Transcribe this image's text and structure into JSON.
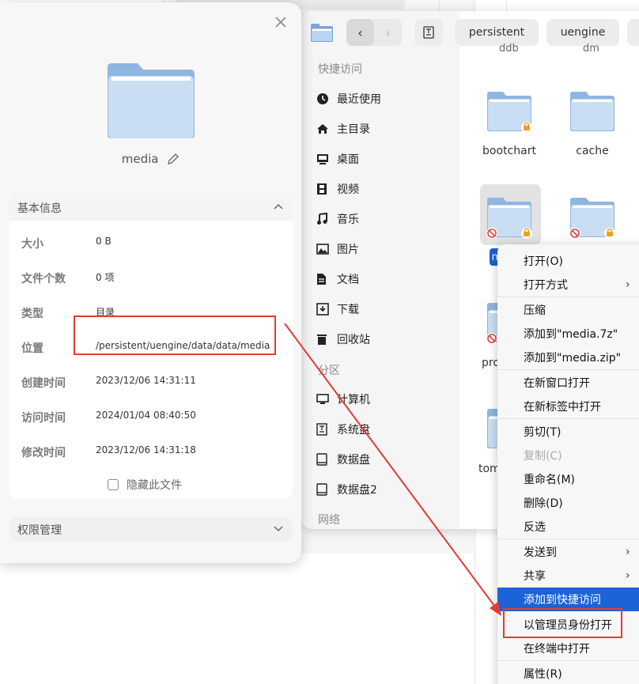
{
  "file_manager": {
    "nav": {
      "back": "‹",
      "forward": "›"
    },
    "breadcrumbs": [
      "persistent",
      "uengine"
    ],
    "sidebar": {
      "quick_access_title": "快捷访问",
      "quick_items": [
        {
          "label": "最近使用",
          "icon": "clock-icon"
        },
        {
          "label": "主目录",
          "icon": "home-icon"
        },
        {
          "label": "桌面",
          "icon": "desktop-icon"
        },
        {
          "label": "视频",
          "icon": "video-icon"
        },
        {
          "label": "音乐",
          "icon": "music-icon"
        },
        {
          "label": "图片",
          "icon": "picture-icon"
        },
        {
          "label": "文档",
          "icon": "document-icon"
        },
        {
          "label": "下载",
          "icon": "download-icon"
        },
        {
          "label": "回收站",
          "icon": "trash-icon"
        }
      ],
      "partition_title": "分区",
      "partition_items": [
        {
          "label": "计算机",
          "icon": "computer-icon"
        },
        {
          "label": "系统盘",
          "icon": "system-disk-icon"
        },
        {
          "label": "数据盘",
          "icon": "disk-icon"
        },
        {
          "label": "数据盘2",
          "icon": "disk-icon"
        }
      ],
      "network_title": "网络"
    },
    "ghost_labels": [
      "ddb",
      "dm"
    ],
    "files": [
      {
        "name": "bootchart",
        "locked": true,
        "blocked": false
      },
      {
        "name": "cache",
        "locked": false,
        "blocked": false
      },
      {
        "name": "m",
        "locked": true,
        "blocked": true,
        "selected": true
      },
      {
        "name": "",
        "locked": true,
        "blocked": true
      },
      {
        "name": "pro",
        "locked": false,
        "blocked": true
      },
      {
        "name": "tom",
        "locked": false,
        "blocked": false
      }
    ]
  },
  "properties": {
    "file_name": "media",
    "basic_info_title": "基本信息",
    "rows": [
      {
        "label": "大小",
        "value": "0 B"
      },
      {
        "label": "文件个数",
        "value": "0 项"
      },
      {
        "label": "类型",
        "value": "目录"
      },
      {
        "label": "位置",
        "value": "/persistent/uengine/data/data/media"
      },
      {
        "label": "创建时间",
        "value": "2023/12/06 14:31:11"
      },
      {
        "label": "访问时间",
        "value": "2024/01/04 08:40:50"
      },
      {
        "label": "修改时间",
        "value": "2023/12/06 14:31:18"
      }
    ],
    "hide_file_label": "隐藏此文件",
    "permissions_title": "权限管理"
  },
  "context_menu": {
    "items": [
      {
        "label": "打开(O)",
        "submenu": false,
        "disabled": false
      },
      {
        "label": "打开方式",
        "submenu": true,
        "disabled": false
      },
      {
        "label": "压缩",
        "submenu": false,
        "disabled": false
      },
      {
        "label": "添加到\"media.7z\"",
        "submenu": false,
        "disabled": false
      },
      {
        "label": "添加到\"media.zip\"",
        "submenu": false,
        "disabled": false
      },
      {
        "label": "在新窗口打开",
        "submenu": false,
        "disabled": false
      },
      {
        "label": "在新标签中打开",
        "submenu": false,
        "disabled": false
      },
      {
        "label": "剪切(T)",
        "submenu": false,
        "disabled": false
      },
      {
        "label": "复制(C)",
        "submenu": false,
        "disabled": true
      },
      {
        "label": "重命名(M)",
        "submenu": false,
        "disabled": false
      },
      {
        "label": "删除(D)",
        "submenu": false,
        "disabled": false
      },
      {
        "label": "反选",
        "submenu": false,
        "disabled": false
      },
      {
        "label": "发送到",
        "submenu": true,
        "disabled": false
      },
      {
        "label": "共享",
        "submenu": true,
        "disabled": false
      },
      {
        "label": "添加到快捷访问",
        "submenu": false,
        "disabled": false,
        "highlighted": true
      },
      {
        "label": "以管理员身份打开",
        "submenu": false,
        "disabled": false,
        "annotated": true
      },
      {
        "label": "在终端中打开",
        "submenu": false,
        "disabled": false
      },
      {
        "label": "属性(R)",
        "submenu": false,
        "disabled": false
      }
    ],
    "submenu_arrow": "›"
  },
  "colors": {
    "accent": "#1b63d6",
    "annotation_red": "#e23b35",
    "folder_light": "#c9def3",
    "folder_dark": "#8fb6e0"
  }
}
